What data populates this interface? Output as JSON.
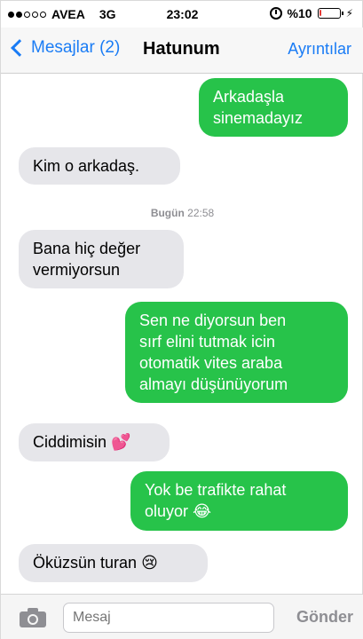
{
  "status_bar": {
    "carrier": "AVEA",
    "network": "3G",
    "time": "23:02",
    "battery_text": "%10",
    "battery_level": 0.1,
    "signal_bars": 2
  },
  "nav": {
    "back_label": "Mesajlar (2)",
    "title": "Hatunum",
    "details_label": "Ayrıntılar"
  },
  "messages": [
    {
      "type": "sent",
      "text": "Arkadaşla\nsinemadayız"
    },
    {
      "type": "received",
      "text": "Kim o arkadaş."
    },
    {
      "type": "received",
      "text": "Bana hiç değer\nvermiyorsun"
    },
    {
      "type": "sent",
      "text": "Sen ne diyorsun ben\nsırf elini tutmak icin\notomatik vites araba\nalmayı düşünüyorum"
    },
    {
      "type": "received",
      "text": "Ciddimisin",
      "emoji": "💕"
    },
    {
      "type": "sent",
      "text": "Yok be trafikte rahat\noluyor",
      "emoji": "😂"
    },
    {
      "type": "received",
      "text": "Öküzsün turan",
      "emoji": "😢"
    }
  ],
  "timestamp": {
    "day": "Bugün",
    "time": "22:58"
  },
  "composer": {
    "placeholder": "Mesaj",
    "send_label": "Gönder"
  },
  "colors": {
    "accent": "#1a7cf5",
    "sent_bubble": "#27c34a",
    "received_bubble": "#e6e6ea",
    "battery_low": "#e53935"
  },
  "icons": [
    "alarm-icon",
    "battery-icon",
    "charging-bolt-icon",
    "back-chevron-icon",
    "camera-icon",
    "two-hearts-emoji",
    "tears-of-joy-emoji",
    "crying-face-emoji"
  ]
}
